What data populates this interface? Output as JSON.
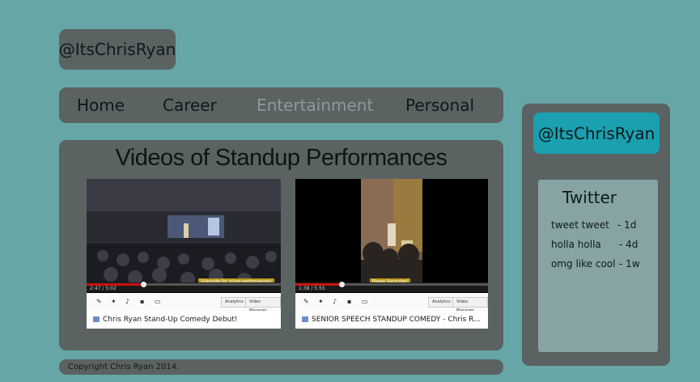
{
  "header": {
    "handle": "@ItsChrisRyan"
  },
  "nav": {
    "items": [
      "Home",
      "Career",
      "Entertainment",
      "Personal"
    ],
    "active": "Entertainment"
  },
  "main": {
    "title": "Videos of Standup Performances",
    "videos": [
      {
        "caption": "Chris Ryan Stand-Up Comedy Debut!",
        "time": "2:47 / 5:02",
        "overlay": "Subscribe for future performances!",
        "analytics_label": "Analytics",
        "manager_label": "Video Manager",
        "progress": 0.29
      },
      {
        "caption": "SENIOR SPEECH STANDUP COMEDY - Chris R...",
        "time": "1:38 / 5:55",
        "overlay": "Please Subscribe!",
        "analytics_label": "Analytics",
        "manager_label": "Video Manager",
        "progress": 0.24
      }
    ]
  },
  "footer": {
    "copyright": "Copyright Chris Ryan 2014."
  },
  "sidebar": {
    "handle": "@ItsChrisRyan",
    "twitter_title": "Twitter",
    "tweets": [
      {
        "text": "tweet tweet",
        "age": "- 1d"
      },
      {
        "text": "holla holla",
        "age": "- 4d"
      },
      {
        "text": "omg like cool",
        "age": "- 1w"
      }
    ]
  },
  "colors": {
    "background": "#66a6a6",
    "panel": "#5a6262",
    "accent": "#1ba0b0",
    "twitter_panel": "#87a3a3"
  }
}
